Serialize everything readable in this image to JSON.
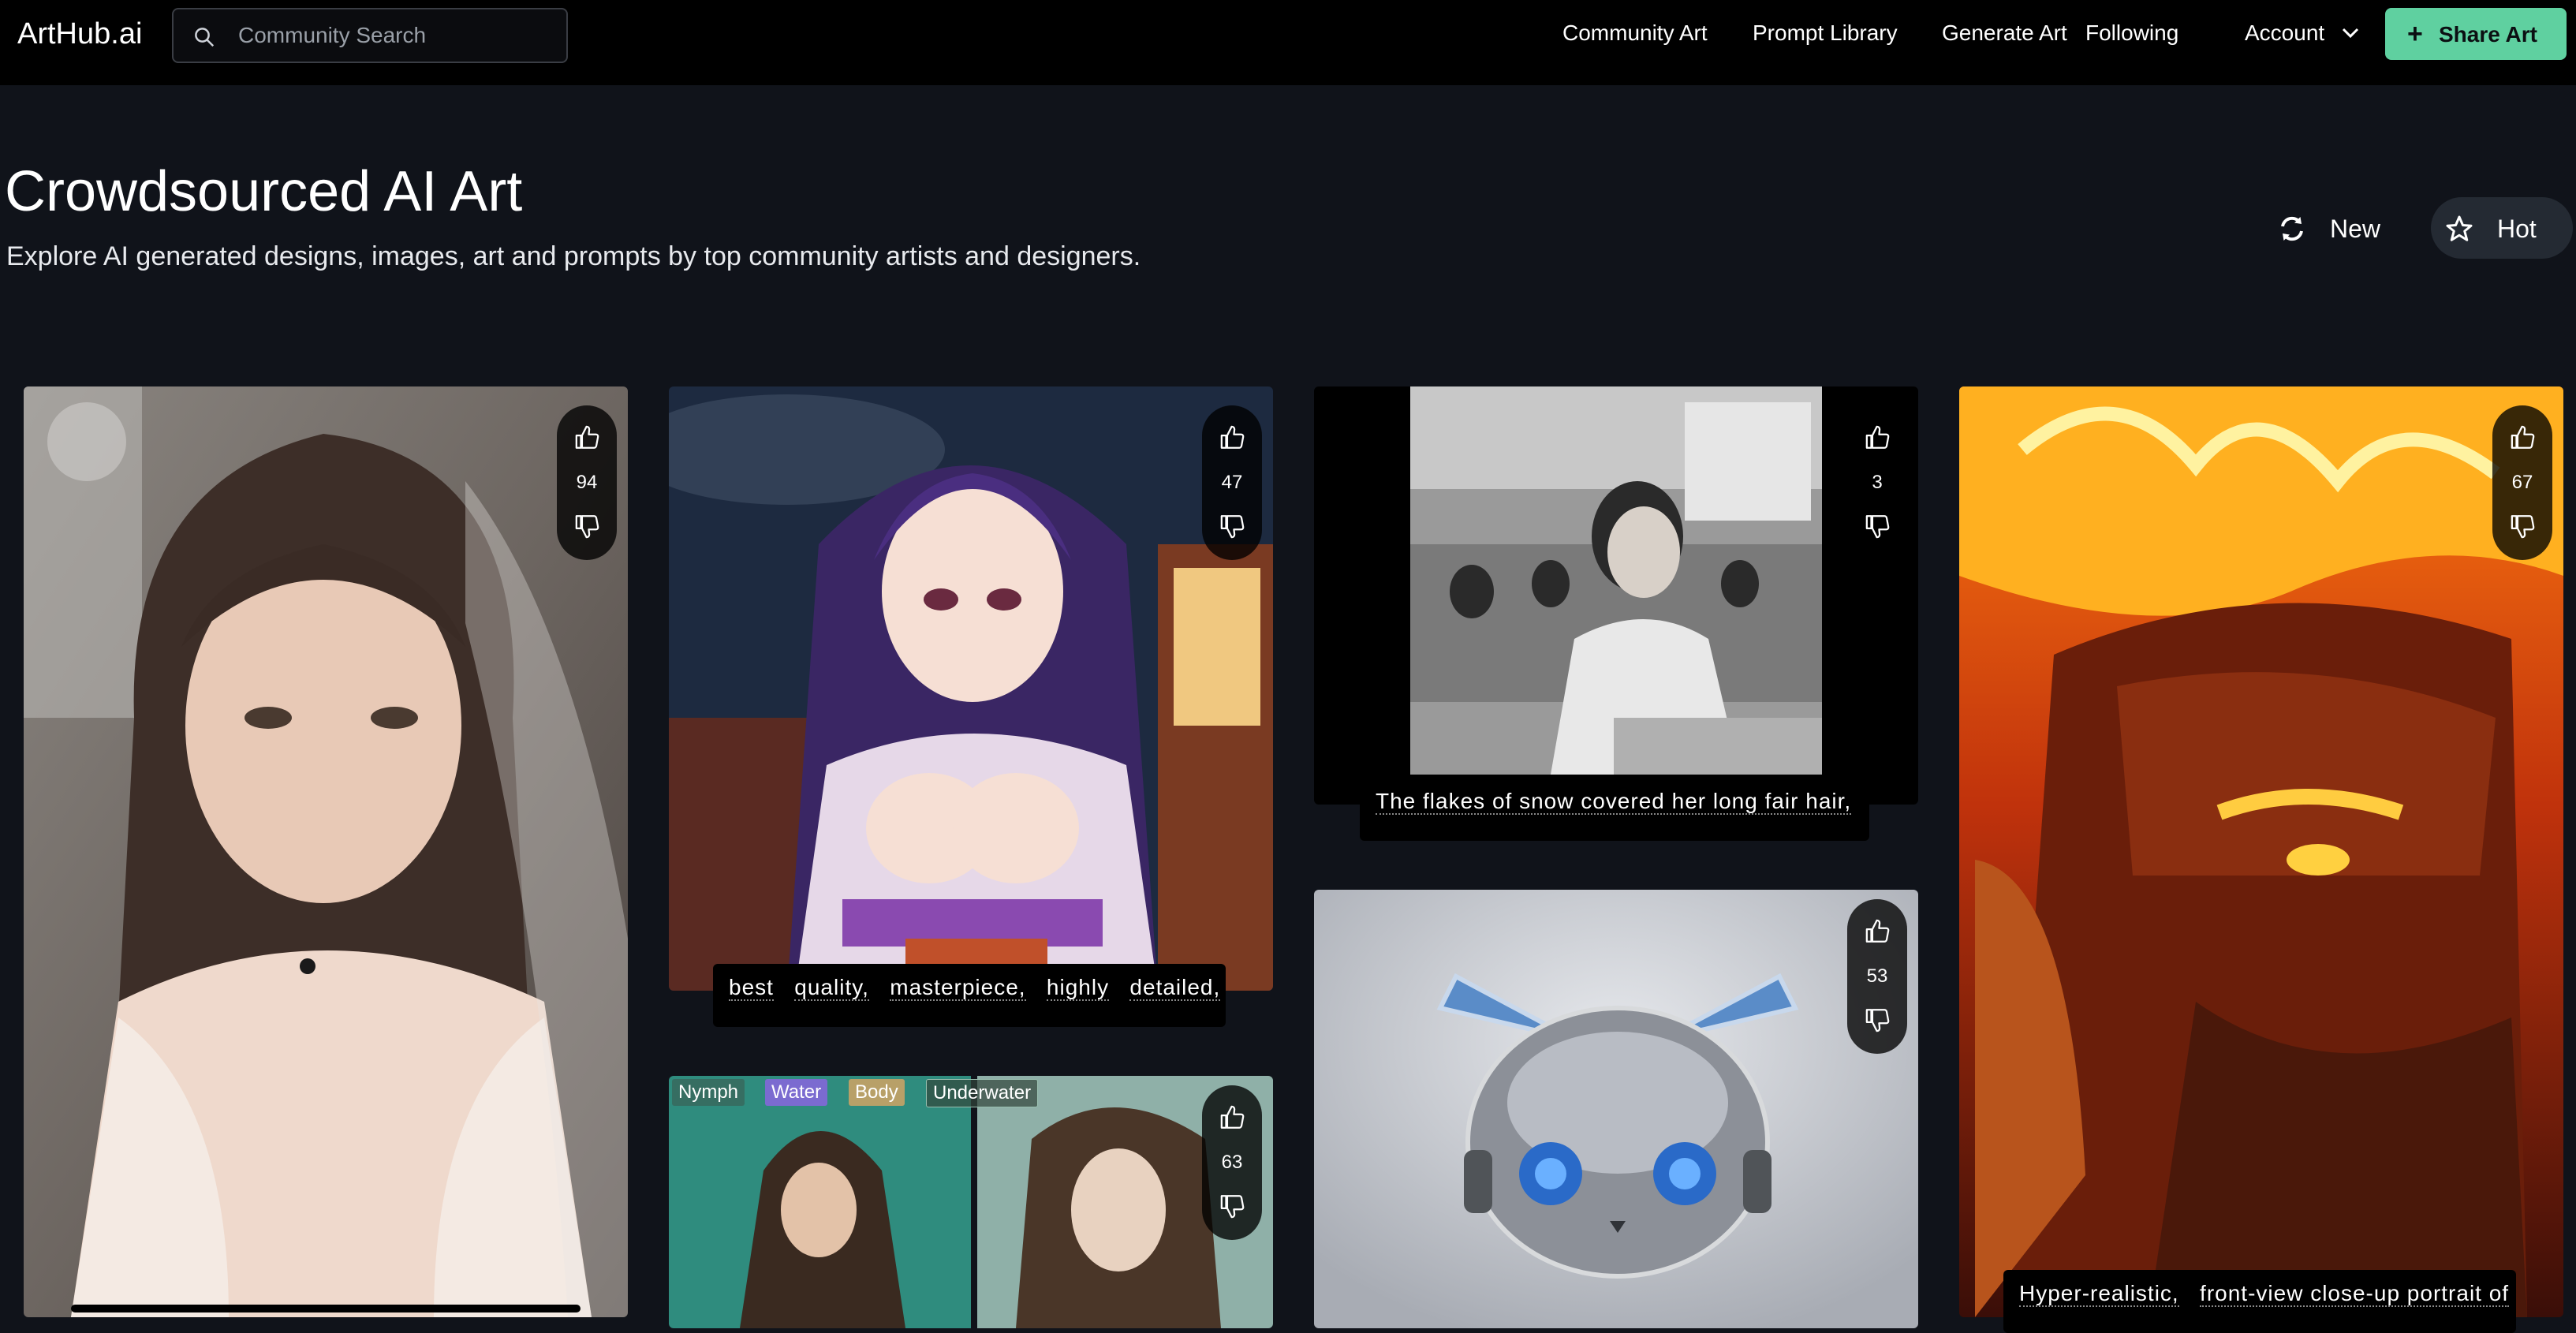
{
  "app": {
    "logo": "ArtHub.ai",
    "search_placeholder": "Community Search",
    "nav": [
      "Community Art",
      "Prompt Library",
      "Generate Art",
      "Following",
      "Account"
    ],
    "share_label": "Share Art",
    "accent_color": "#5fd0a0"
  },
  "page": {
    "title": "Crowdsourced AI Art",
    "subtitle": "Explore AI generated designs, images, art and prompts by top community artists and designers.",
    "sort_new": "New",
    "sort_hot": "Hot"
  },
  "cards": {
    "bride": {
      "votes": "94"
    },
    "anime": {
      "votes": "47",
      "caption": [
        "best",
        "quality,",
        "masterpiece,",
        "highly",
        "detailed,"
      ]
    },
    "classroom": {
      "votes": "3",
      "caption": "The flakes of snow covered her long fair hair,"
    },
    "warrior": {
      "votes": "67",
      "caption": [
        "Hyper-realistic,",
        "front-view close-up portrait of"
      ]
    },
    "cat": {
      "votes": "53"
    },
    "underwater": {
      "votes": "63",
      "tags": [
        "Nymph",
        "Water",
        "Body",
        "Underwater"
      ]
    }
  }
}
